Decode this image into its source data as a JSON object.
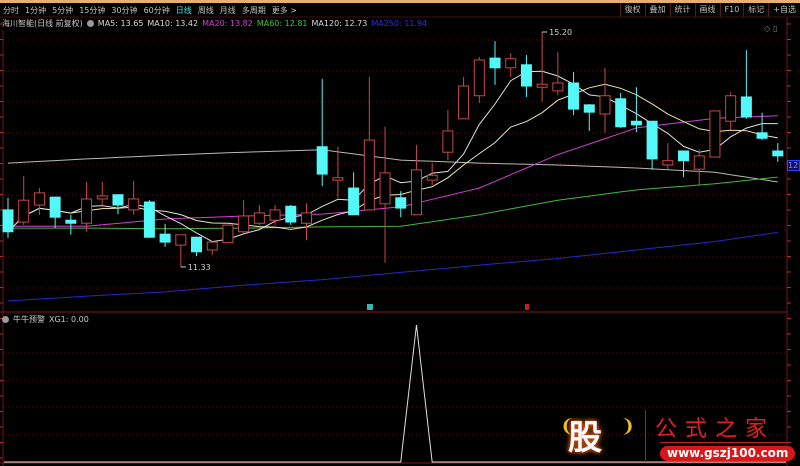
{
  "periods": [
    "分时",
    "1分钟",
    "5分钟",
    "15分钟",
    "30分钟",
    "60分钟",
    "日线",
    "周线",
    "月线",
    "多周期",
    "更多 >"
  ],
  "active_period": "日线",
  "tool_buttons": [
    "復权",
    "叠加",
    "统计",
    "画线",
    "F10",
    "标记",
    "+自选"
  ],
  "stock_title": "海川智能(日线 前复权)",
  "ma_legend": [
    {
      "label": "MA5: 13.65",
      "color": "#d8d8d8"
    },
    {
      "label": "MA10: 13.42",
      "color": "#d8d8d8"
    },
    {
      "label": "MA20: 13.82",
      "color": "#d040d0"
    },
    {
      "label": "MA60: 12.81",
      "color": "#40c040"
    },
    {
      "label": "MA120: 12.73",
      "color": "#d8d8d8"
    },
    {
      "label": "MA250: 11.94",
      "color": "#3030d0"
    }
  ],
  "price_tag": "12.",
  "high_label": "15.20",
  "low_label": "11.33",
  "indicator": {
    "title": "牛牛预警",
    "value_label": "XG1: 0.00"
  },
  "watermark": {
    "logo": "股",
    "title": "公式之家",
    "url": "www.gszj100.com"
  },
  "colors": {
    "up": "#c84848",
    "down": "#54f8f8",
    "grid": "#5a1010",
    "ma5": "#e0e0e0",
    "ma10": "#e8e8b0",
    "ma20": "#d040d0",
    "ma60": "#40b840",
    "ma120": "#b8b8b8",
    "ma250": "#2828c0"
  },
  "chart_data": {
    "type": "candlestick",
    "ohlc": [
      [
        12.27,
        12.47,
        11.81,
        11.91
      ],
      [
        12.07,
        12.83,
        12.02,
        12.43
      ],
      [
        12.35,
        12.63,
        12.19,
        12.55
      ],
      [
        12.48,
        12.48,
        11.97,
        12.15
      ],
      [
        12.1,
        12.19,
        11.86,
        12.05
      ],
      [
        12.05,
        12.73,
        11.91,
        12.45
      ],
      [
        12.45,
        12.73,
        12.32,
        12.5
      ],
      [
        12.52,
        12.52,
        12.2,
        12.35
      ],
      [
        12.27,
        12.75,
        12.19,
        12.45
      ],
      [
        12.4,
        12.43,
        11.81,
        11.82
      ],
      [
        11.87,
        12.04,
        11.66,
        11.74
      ],
      [
        11.69,
        11.86,
        11.33,
        11.86
      ],
      [
        11.82,
        11.82,
        11.51,
        11.58
      ],
      [
        11.61,
        11.74,
        11.53,
        11.74
      ],
      [
        11.73,
        12.02,
        11.73,
        12.02
      ],
      [
        11.91,
        12.43,
        11.89,
        12.17
      ],
      [
        12.05,
        12.35,
        12.02,
        12.22
      ],
      [
        12.1,
        12.35,
        12.02,
        12.27
      ],
      [
        12.33,
        12.35,
        12.02,
        12.07
      ],
      [
        12.05,
        12.38,
        11.77,
        12.22
      ],
      [
        13.31,
        14.43,
        12.66,
        12.86
      ],
      [
        12.76,
        13.31,
        12.47,
        12.8
      ],
      [
        12.63,
        12.89,
        12.19,
        12.19
      ],
      [
        12.27,
        14.46,
        12.27,
        13.42
      ],
      [
        12.37,
        13.64,
        11.4,
        12.88
      ],
      [
        12.47,
        12.58,
        12.15,
        12.3
      ],
      [
        12.19,
        13.34,
        12.19,
        12.93
      ],
      [
        12.76,
        13.04,
        12.68,
        12.84
      ],
      [
        13.22,
        13.92,
        13.09,
        13.57
      ],
      [
        13.77,
        14.46,
        13.77,
        14.31
      ],
      [
        14.15,
        14.79,
        14.03,
        14.74
      ],
      [
        14.77,
        15.05,
        14.33,
        14.61
      ],
      [
        14.61,
        14.85,
        14.46,
        14.76
      ],
      [
        14.66,
        14.82,
        14.13,
        14.31
      ],
      [
        14.29,
        15.2,
        14.05,
        14.34
      ],
      [
        14.23,
        14.87,
        14.16,
        14.36
      ],
      [
        14.36,
        14.54,
        13.83,
        13.93
      ],
      [
        14.0,
        14.01,
        13.57,
        13.88
      ],
      [
        13.85,
        14.61,
        13.54,
        14.15
      ],
      [
        14.1,
        14.2,
        13.62,
        13.64
      ],
      [
        13.73,
        14.29,
        13.55,
        13.67
      ],
      [
        13.73,
        13.73,
        12.93,
        13.11
      ],
      [
        13.01,
        13.37,
        12.94,
        13.08
      ],
      [
        13.24,
        13.24,
        12.81,
        13.08
      ],
      [
        12.94,
        13.27,
        12.68,
        13.16
      ],
      [
        13.14,
        13.9,
        13.14,
        13.9
      ],
      [
        13.73,
        14.21,
        13.59,
        14.15
      ],
      [
        14.13,
        14.9,
        13.77,
        13.8
      ],
      [
        13.54,
        13.87,
        13.42,
        13.45
      ],
      [
        13.24,
        13.37,
        13.06,
        13.16
      ]
    ],
    "ma_samples": {
      "index": [
        0,
        5,
        10,
        15,
        20,
        25,
        30,
        35,
        40,
        45,
        49
      ],
      "ma20": [
        12.0,
        12.0,
        12.12,
        12.17,
        12.2,
        12.32,
        12.63,
        13.18,
        13.62,
        13.78,
        13.82
      ],
      "ma60": [
        11.97,
        11.97,
        11.96,
        11.97,
        11.99,
        12.0,
        12.19,
        12.43,
        12.6,
        12.7,
        12.81
      ],
      "ma120": [
        13.04,
        13.11,
        13.17,
        13.22,
        13.26,
        13.09,
        13.04,
        13.01,
        12.96,
        12.89,
        12.73
      ],
      "ma250": [
        10.77,
        10.85,
        10.92,
        11.03,
        11.12,
        11.24,
        11.36,
        11.47,
        11.61,
        11.75,
        11.9
      ]
    },
    "high": {
      "index": 34,
      "value": 15.2
    },
    "low": {
      "index": 11,
      "value": 11.33
    },
    "xg1": {
      "signal_index": 26,
      "values_max": 1,
      "current": 0.0
    }
  }
}
